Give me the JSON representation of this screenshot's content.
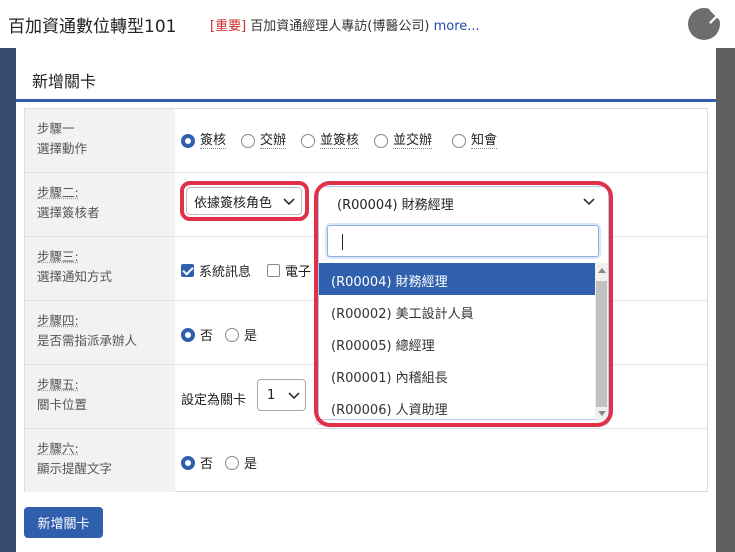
{
  "app": {
    "title": "百加資通數位轉型101"
  },
  "notice": {
    "tag": "[重要]",
    "text": " 百加資通經理人專訪(博醫公司) ",
    "more": "more..."
  },
  "modal": {
    "title": "新增關卡",
    "submit_label": "新增關卡"
  },
  "steps": [
    {
      "step": "步驟一",
      "desc": "選擇動作"
    },
    {
      "step": "步驟二:",
      "desc": "選擇簽核者"
    },
    {
      "step": "步驟三:",
      "desc": "選擇通知方式"
    },
    {
      "step": "步驟四:",
      "desc": "是否需指派承辦人"
    },
    {
      "step": "步驟五:",
      "desc": "關卡位置"
    },
    {
      "step": "步驟六:",
      "desc": "顯示提醒文字"
    }
  ],
  "step1": {
    "options": [
      "簽核",
      "交辦",
      "並簽核",
      "並交辦",
      "知會"
    ],
    "selected": "簽核"
  },
  "step2": {
    "mode_select": "依據簽核角色",
    "role_select": "(R00004) 財務經理",
    "search_value": "",
    "options": [
      "(R00004) 財務經理",
      "(R00002) 美工設計人員",
      "(R00005) 總經理",
      "(R00001) 內稽組長",
      "(R00006) 人資助理"
    ],
    "highlighted": "(R00004) 財務經理"
  },
  "step3": {
    "options": [
      {
        "label": "系統訊息",
        "checked": true
      },
      {
        "label": "電子",
        "checked": false
      }
    ]
  },
  "step4": {
    "options": [
      "否",
      "是"
    ],
    "selected": "否"
  },
  "step5": {
    "prefix": "設定為關卡",
    "position": "1"
  },
  "step6": {
    "options": [
      "否",
      "是"
    ],
    "selected": "否"
  },
  "colors": {
    "primary": "#2f5fad",
    "highlight": "#e0304a",
    "notice_tag": "#c9302c"
  }
}
